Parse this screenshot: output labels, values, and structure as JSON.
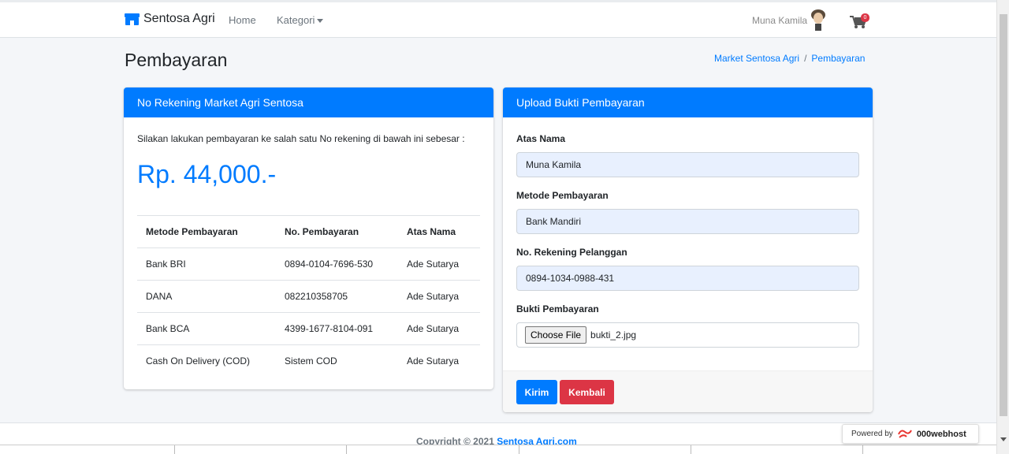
{
  "navbar": {
    "brand": "Sentosa Agri",
    "links": [
      "Home",
      "Kategori"
    ],
    "user_name": "Muna Kamila",
    "cart_count": "0"
  },
  "header": {
    "title": "Pembayaran",
    "breadcrumb": [
      "Market Sentosa Agri",
      "/",
      "Pembayaran"
    ]
  },
  "rekening": {
    "title": "No Rekening Market Agri Sentosa",
    "intro": "Silakan lakukan pembayaran ke salah satu No rekening di bawah ini sebesar :",
    "amount": "Rp. 44,000.-",
    "columns": [
      "Metode Pembayaran",
      "No. Pembayaran",
      "Atas Nama"
    ],
    "rows": [
      [
        "Bank BRI",
        "0894-0104-7696-530",
        "Ade Sutarya"
      ],
      [
        "DANA",
        "082210358705",
        "Ade Sutarya"
      ],
      [
        "Bank BCA",
        "4399-1677-8104-091",
        "Ade Sutarya"
      ],
      [
        "Cash On Delivery (COD)",
        "Sistem COD",
        "Ade Sutarya"
      ]
    ]
  },
  "upload": {
    "title": "Upload Bukti Pembayaran",
    "atas_nama_label": "Atas Nama",
    "atas_nama_value": "Muna Kamila",
    "metode_label": "Metode Pembayaran",
    "metode_value": "Bank Mandiri",
    "rekening_label": "No. Rekening Pelanggan",
    "rekening_value": "0894-1034-0988-431",
    "bukti_label": "Bukti Pembayaran",
    "file_button": "Choose File",
    "file_name": "bukti_2.jpg",
    "submit": "Kirim",
    "back": "Kembali"
  },
  "footer": {
    "copyright": "Copyright © 2021",
    "site": "Sentosa Agri.com",
    "powered_by": "Powered by",
    "host": "000webhost"
  },
  "colors": {
    "primary": "#007bff",
    "danger": "#dc3545",
    "input_bg": "#e8f0fe"
  }
}
